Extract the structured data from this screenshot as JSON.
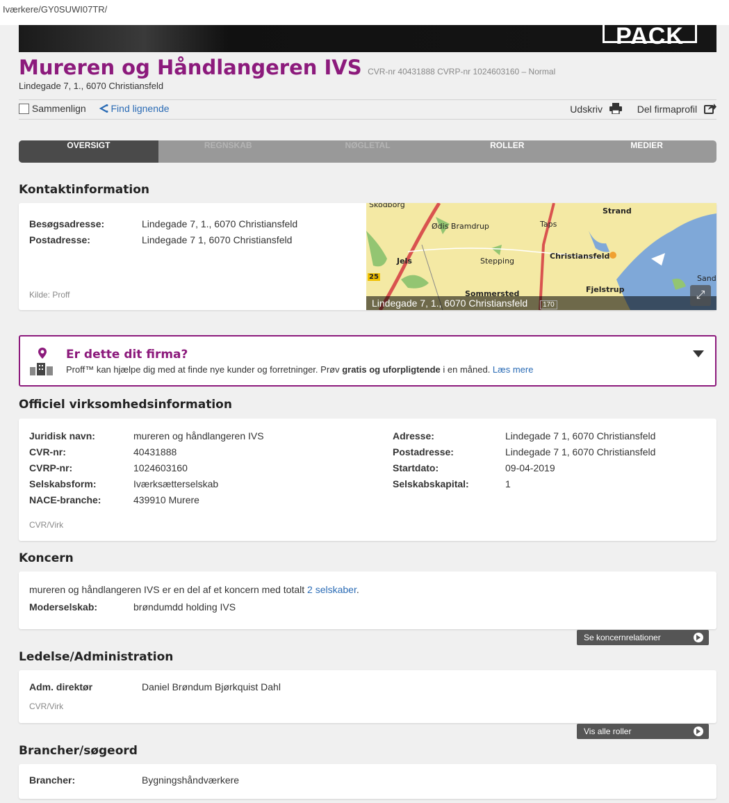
{
  "url": "Iværkere/GY0SUWI07TR/",
  "hero": {
    "logo_text": "PACK"
  },
  "company": {
    "name": "Mureren og Håndlangeren IVS",
    "meta": "CVR-nr 40431888 CVRP-nr 1024603160 – Normal",
    "address": "Lindegade 7, 1., 6070 Christiansfeld",
    "accent_color": "#8c1a7c"
  },
  "toolbar": {
    "compare": "Sammenlign",
    "find_similar": "Find lignende",
    "print": "Udskriv",
    "share": "Del firmaprofil",
    "icons": [
      "checkbox",
      "share-arrows-icon",
      "printer-icon",
      "share-export-icon"
    ]
  },
  "tabs": [
    {
      "label": "Oversigt",
      "state": "active"
    },
    {
      "label": "Regnskab",
      "state": "disabled"
    },
    {
      "label": "Nøgletal",
      "state": "disabled"
    },
    {
      "label": "Roller",
      "state": "enabled"
    },
    {
      "label": "Medier",
      "state": "enabled"
    }
  ],
  "contact": {
    "title": "Kontaktinformation",
    "visit_label": "Besøgsadresse:",
    "visit_value": "Lindegade 7, 1., 6070 Christiansfeld",
    "post_label": "Postadresse:",
    "post_value": "Lindegade 7 1, 6070 Christiansfeld",
    "source": "Kilde: Proff",
    "map": {
      "places": [
        "Skodborg",
        "Ødis Bramdrup",
        "Taps",
        "Strand",
        "Jels",
        "Stepping",
        "Christiansfeld",
        "Sand",
        "Fjelstrup",
        "Sommersted"
      ],
      "road_numbers": [
        "25",
        "170"
      ],
      "caption": "Lindegade 7, 1., 6070 Christiansfeld",
      "expand_icon": "expand-arrows-icon"
    }
  },
  "promo": {
    "title": "Er dette dit firma?",
    "text_before": "Proff™ kan hjælpe dig med at finde nye kunder og forretninger. Prøv ",
    "text_bold": "gratis og uforpligtende",
    "text_after": " i en måned. ",
    "link": "Læs mere",
    "icons": [
      "location-pin-icon",
      "buildings-icon",
      "caret-down-icon"
    ]
  },
  "official": {
    "title": "Officiel virksomhedsinformation",
    "left": [
      {
        "label": "Juridisk navn:",
        "value": "mureren og håndlangeren IVS"
      },
      {
        "label": "CVR-nr:",
        "value": "40431888"
      },
      {
        "label": "CVRP-nr:",
        "value": "1024603160"
      },
      {
        "label": "Selskabsform:",
        "value": "Iværksætterselskab"
      },
      {
        "label": "NACE-branche:",
        "value": "439910 Murere"
      }
    ],
    "right": [
      {
        "label": "Adresse:",
        "value": "Lindegade 7 1, 6070 Christiansfeld"
      },
      {
        "label": "Postadresse:",
        "value": "Lindegade 7 1, 6070 Christiansfeld"
      },
      {
        "label": "Startdato:",
        "value": "09-04-2019"
      },
      {
        "label": "Selskabskapital:",
        "value": "1"
      }
    ],
    "source": "CVR/Virk"
  },
  "koncern": {
    "title": "Koncern",
    "sentence": "mureren og håndlangeren IVS er en del af et koncern med totalt ",
    "sentence_link": "2 selskaber",
    "sentence_end": ".",
    "parent_label": "Moderselskab:",
    "parent_value": "brøndumdd holding IVS",
    "button": "Se koncernrelationer"
  },
  "ledelse": {
    "title": "Ledelse/Administration",
    "role_label": "Adm. direktør",
    "role_value": "Daniel Brøndum Bjørkquist Dahl",
    "source": "CVR/Virk",
    "button": "Vis alle roller"
  },
  "brancher": {
    "title": "Brancher/søgeord",
    "label": "Brancher:",
    "value": "Bygningshåndværkere"
  }
}
